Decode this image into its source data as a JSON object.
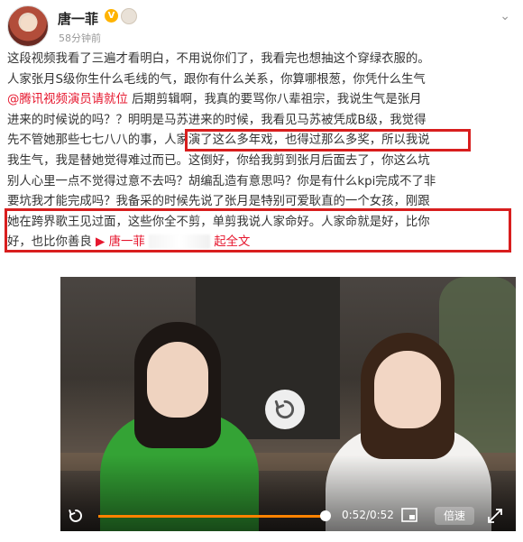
{
  "author": {
    "name": "唐一菲",
    "verified_badge": "V",
    "time": "58分钟前"
  },
  "post": {
    "line1": "这段视频我看了三遍才看明白，不用说你们了，我看完也想抽这个穿绿衣服的。",
    "line2": "人家张月S级你生什么毛线的气，跟你有什么关系，你算哪根葱，你凭什么生气",
    "line3_mention": "@腾讯视频演员请就位",
    "line3_rest": " 后期剪辑啊，我真的要骂你八辈祖宗，我说生气是张月",
    "line4_pre": "进来的时候说的吗？？",
    "line4_highlight": "明明是马苏进来的时候，我看见马苏被凭成B级，",
    "line4_post": "我觉得",
    "line5": "先不管她那些七七八八的事，人家演了这么多年戏，也得过那么多奖，所以我说",
    "line6": "我生气，我是替她觉得难过而已。这倒好，你给我剪到张月后面去了，你这么坑",
    "line7": "别人心里一点不觉得过意不去吗？胡编乱造有意思吗？你是有什么kpi完成不了非",
    "line8": "要坑我才能完成吗？我备采的时候先说了张月是特别可爱耿直的一个女孩，刚跟",
    "line9": "她在跨界歌王见过面，这些你全不剪，单剪我说人家命好。人家命就是好，比你",
    "line10_pre": "好，也比你善良 ",
    "line10_link_name": "唐一菲",
    "line10_fulltext": "起全文",
    "link_icon": "video-link-icon"
  },
  "highlights": {
    "color": "#d81e1e"
  },
  "video": {
    "progress": 1.0,
    "time_text": "0:52/0:52",
    "speed_label": "倍速",
    "replay_icon": "replay-icon",
    "accent": "#ff8200"
  }
}
